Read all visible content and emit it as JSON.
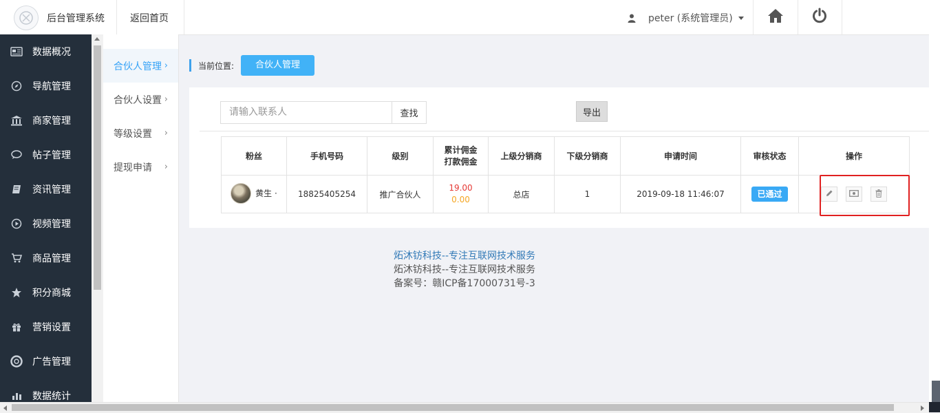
{
  "header": {
    "app_title": "后台管理系统",
    "home_link": "返回首页",
    "user": "peter (系统管理员)"
  },
  "sidebar": {
    "items": [
      {
        "label": "数据概况",
        "icon": "dashboard-icon"
      },
      {
        "label": "导航管理",
        "icon": "compass-icon"
      },
      {
        "label": "商家管理",
        "icon": "bank-icon"
      },
      {
        "label": "帖子管理",
        "icon": "comment-icon"
      },
      {
        "label": "资讯管理",
        "icon": "book-icon"
      },
      {
        "label": "视频管理",
        "icon": "play-icon"
      },
      {
        "label": "商品管理",
        "icon": "cart-icon"
      },
      {
        "label": "积分商城",
        "icon": "star-icon"
      },
      {
        "label": "营销设置",
        "icon": "gift-icon"
      },
      {
        "label": "广告管理",
        "icon": "lifebuoy-icon"
      },
      {
        "label": "数据统计",
        "icon": "chart-icon"
      }
    ]
  },
  "submenu": {
    "items": [
      {
        "label": "合伙人管理",
        "active": true
      },
      {
        "label": "合伙人设置",
        "active": false
      },
      {
        "label": "等级设置",
        "active": false
      },
      {
        "label": "提现申请",
        "active": false
      }
    ]
  },
  "breadcrumb": {
    "label": "当前位置:",
    "current": "合伙人管理"
  },
  "toolbar": {
    "search_placeholder": "请输入联系人",
    "search_button": "查找",
    "export_button": "导出"
  },
  "table": {
    "headers": {
      "fan": "粉丝",
      "phone": "手机号码",
      "level": "级别",
      "commission_line1": "累计佣金",
      "commission_line2": "打款佣金",
      "upper": "上级分销商",
      "lower": "下级分销商",
      "apply_time": "申请时间",
      "status": "审核状态",
      "ops": "操作"
    },
    "rows": [
      {
        "fan_name": "黄生 ·",
        "phone": "18825405254",
        "level": "推广合伙人",
        "total_commission": "19.00",
        "paid_commission": "0.00",
        "upper": "总店",
        "lower": "1",
        "apply_time": "2019-09-18 11:46:07",
        "status": "已通过"
      }
    ]
  },
  "footer": {
    "link": "炻沐钫科技--专注互联网技术服务",
    "line2": "炻沐钫科技--专注互联网技术服务",
    "icp": "备案号：赣ICP备17000731号-3"
  },
  "colors": {
    "sidebar_bg": "#242f3b",
    "accent": "#41b2f7",
    "badge": "#39a9f5",
    "amount_red": "#e53935",
    "amount_orange": "#f5a623",
    "highlight": "#e02020"
  }
}
